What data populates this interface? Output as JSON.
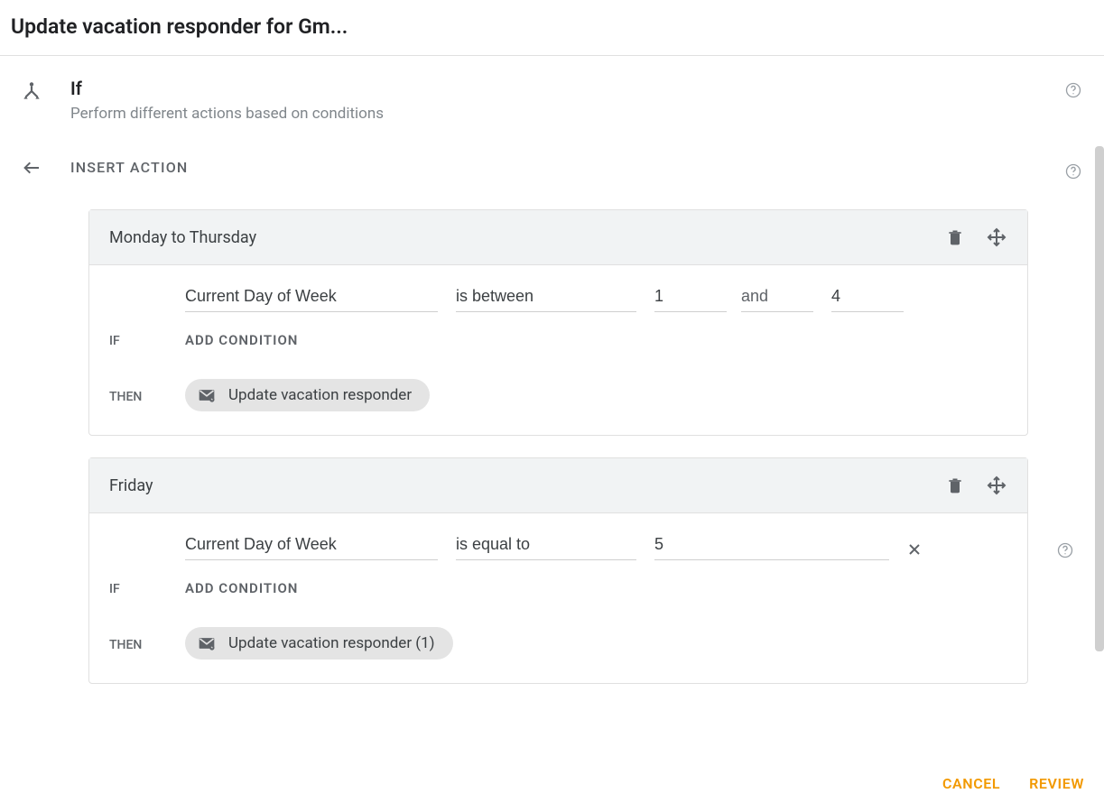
{
  "title": "Update vacation responder for Gm...",
  "if_block": {
    "title": "If",
    "subtitle": "Perform different actions based on conditions",
    "insert_action_label": "INSERT ACTION"
  },
  "branches": [
    {
      "title": "Monday to Thursday",
      "if_label": "IF",
      "subject": "Current Day of Week",
      "operator": "is between",
      "value1": "1",
      "and_text": "and",
      "value2": "4",
      "add_condition_label": "ADD CONDITION",
      "then_label": "THEN",
      "chip_text": "Update vacation responder"
    },
    {
      "title": "Friday",
      "if_label": "IF",
      "subject": "Current Day of Week",
      "operator": "is equal to",
      "value1": "5",
      "add_condition_label": "ADD CONDITION",
      "then_label": "THEN",
      "chip_text": "Update vacation responder (1)"
    }
  ],
  "footer": {
    "cancel": "CANCEL",
    "review": "REVIEW"
  }
}
